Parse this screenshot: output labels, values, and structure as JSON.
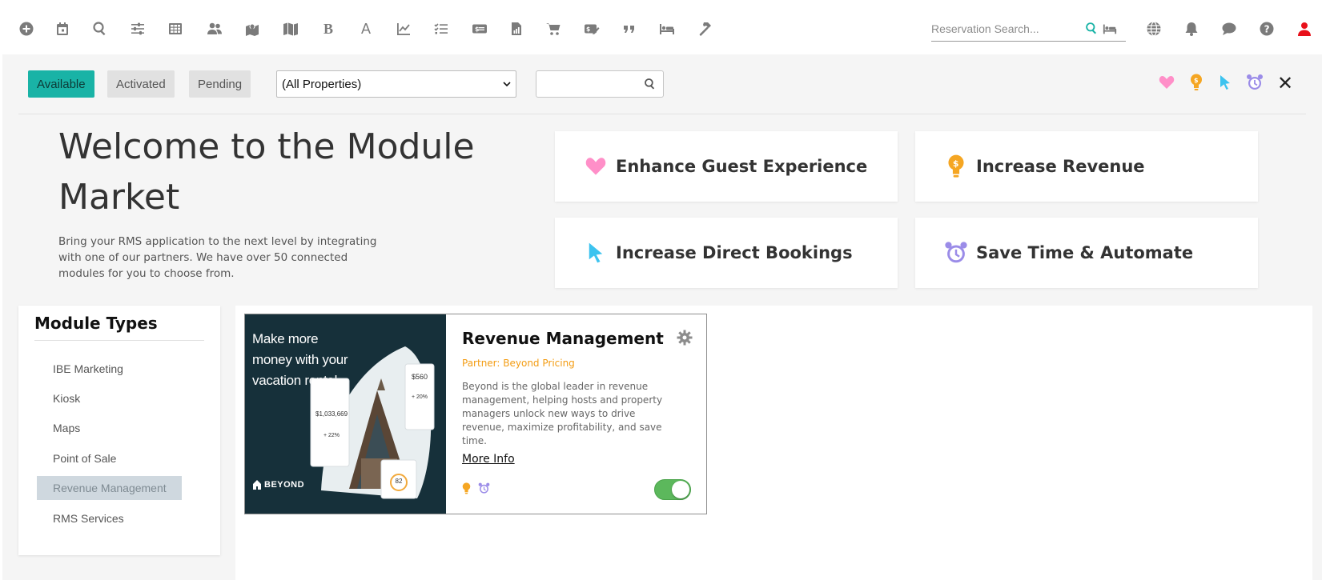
{
  "toolbar": {
    "icons": [
      "add-icon",
      "calendar-icon",
      "search-icon",
      "sliders-icon",
      "grid-icon",
      "users-icon",
      "map-pin-icon",
      "map-icon",
      "bold-icon",
      "font-icon",
      "chart-line-icon",
      "tasks-icon",
      "money-bill-icon",
      "file-invoice-icon",
      "cart-icon",
      "payment-icon",
      "quote-icon",
      "bed-icon",
      "hammer-icon"
    ],
    "letters": {
      "bold": "B",
      "font": "A"
    },
    "reservation_search_placeholder": "Reservation Search...",
    "right_icons": [
      "globe-icon",
      "bell-icon",
      "chat-icon",
      "help-icon",
      "user-icon"
    ]
  },
  "filters": {
    "tabs": [
      {
        "label": "Available",
        "active": true
      },
      {
        "label": "Activated",
        "active": false
      },
      {
        "label": "Pending",
        "active": false
      }
    ],
    "property_select": {
      "value": "(All Properties)"
    },
    "search_value": "",
    "category_icons": [
      "heart-icon",
      "lightbulb-icon",
      "pointer-icon",
      "alarm-clock-icon"
    ],
    "close_label": "✕"
  },
  "welcome": {
    "title": "Welcome to the Module Market",
    "description": "Bring your RMS application to the next level by integrating with one of our partners. We have over 50 connected modules for you to choose from."
  },
  "categories": [
    {
      "label": "Enhance Guest Experience",
      "icon": "heart-icon",
      "color": "#ff8fc8"
    },
    {
      "label": "Increase Revenue",
      "icon": "lightbulb-icon",
      "color": "#f5a623"
    },
    {
      "label": "Increase Direct Bookings",
      "icon": "pointer-icon",
      "color": "#3cc3ef"
    },
    {
      "label": "Save Time & Automate",
      "icon": "alarm-clock-icon",
      "color": "#9b8ce8"
    }
  ],
  "module_types": {
    "title": "Module Types",
    "items": [
      {
        "label": "IBE Marketing",
        "selected": false
      },
      {
        "label": "Kiosk",
        "selected": false
      },
      {
        "label": "Maps",
        "selected": false
      },
      {
        "label": "Point of Sale",
        "selected": false
      },
      {
        "label": "Revenue Management",
        "selected": true
      },
      {
        "label": "RMS Services",
        "selected": false
      }
    ]
  },
  "modules": [
    {
      "name": "Revenue Management",
      "partner": "Partner: Beyond Pricing",
      "description": "Beyond is the global leader in revenue management, helping hosts and property managers unlock new ways to drive revenue, maximize profitability, and save time.",
      "more_info": "More Info",
      "image_headline": "Make more money with your vacation rental.",
      "image_brand": "BEYOND",
      "image_stats": {
        "total_revenue": "$1,033,669",
        "avg_daily_rate": "$560",
        "change_1": "+ 22%",
        "change_2": "+ 20%",
        "portfolio_score": "82"
      },
      "category_icons": [
        "lightbulb-icon",
        "alarm-clock-icon"
      ],
      "enabled": true
    }
  ],
  "colors": {
    "accent": "#19b3a6",
    "partner": "#f39c12",
    "toggle_on": "#5cb85c",
    "user_icon": "#e8101a"
  }
}
